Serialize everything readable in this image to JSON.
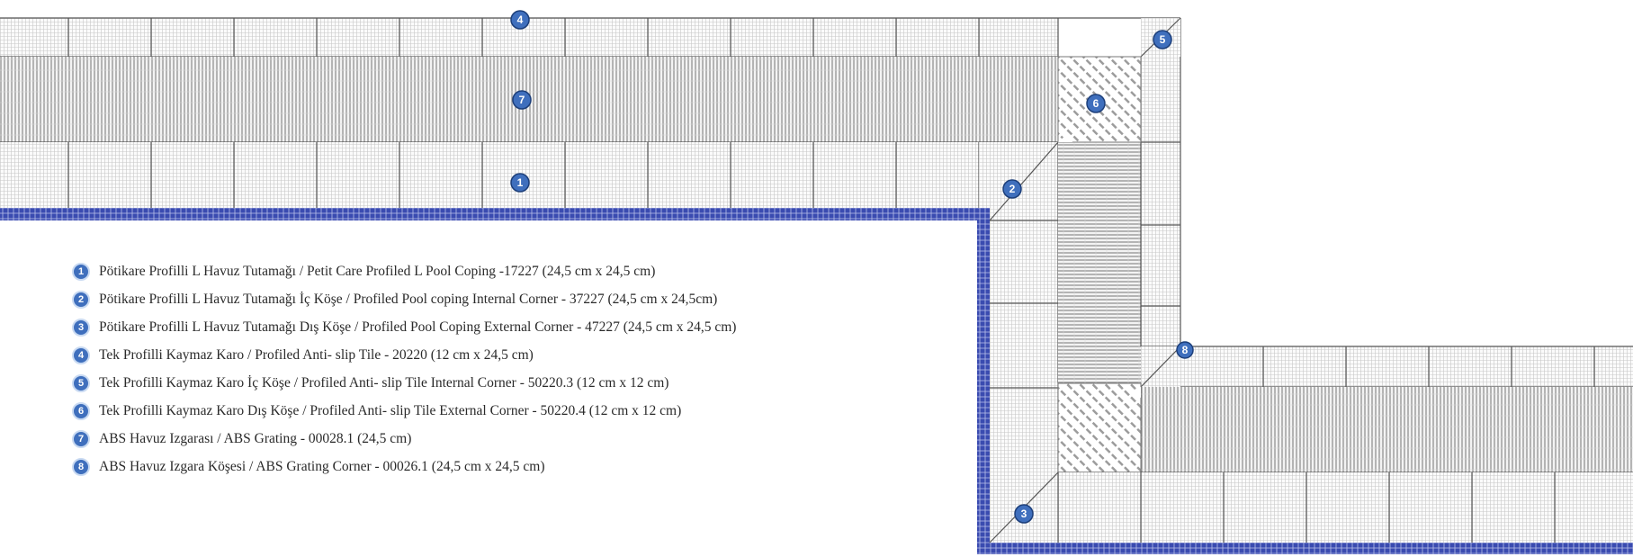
{
  "legend": [
    {
      "num": "1",
      "text": "Pötikare Profilli L Havuz Tutamağı / Petit Care Profiled L Pool Coping -17227 (24,5 cm x 24,5 cm)"
    },
    {
      "num": "2",
      "text": "Pötikare Profilli L Havuz Tutamağı İç Köşe / Profiled Pool coping Internal Corner - 37227 (24,5 cm x 24,5cm)"
    },
    {
      "num": "3",
      "text": "Pötikare Profilli L Havuz Tutamağı Dış Köşe / Profiled Pool Coping External Corner - 47227 (24,5 cm x 24,5 cm)"
    },
    {
      "num": "4",
      "text": "Tek Profilli Kaymaz Karo / Profiled Anti- slip Tile - 20220 (12 cm x 24,5 cm)"
    },
    {
      "num": "5",
      "text": "Tek Profilli Kaymaz Karo İç Köşe / Profiled Anti- slip Tile Internal Corner - 50220.3 (12 cm x 12 cm)"
    },
    {
      "num": "6",
      "text": "Tek Profilli Kaymaz Karo Dış Köşe / Profiled Anti- slip Tile External Corner - 50220.4 (12 cm x 12 cm)"
    },
    {
      "num": "7",
      "text": "ABS Havuz Izgarası / ABS Grating - 00028.1 (24,5 cm)"
    },
    {
      "num": "8",
      "text": "ABS Havuz Izgara Köşesi / ABS Grating Corner - 00026.1 (24,5 cm x 24,5 cm)"
    }
  ],
  "markers": {
    "m1": "1",
    "m2": "2",
    "m3": "3",
    "m4": "4",
    "m5": "5",
    "m6": "6",
    "m7": "7",
    "m8": "8"
  },
  "colors": {
    "tile_line": "#9a9a9a",
    "tile_border": "#555555",
    "edge_band": "#3a4bb0",
    "marker_fill": "#3f6fbd"
  }
}
